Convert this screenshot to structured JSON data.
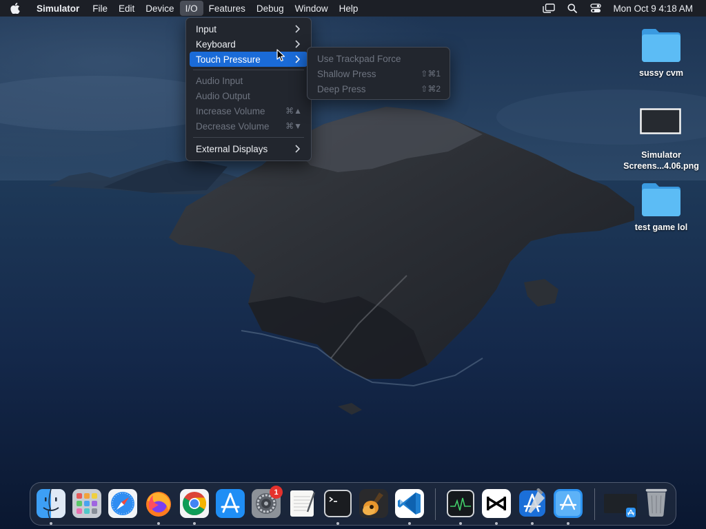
{
  "menubar": {
    "apple_icon": "apple-logo-icon",
    "app_name": "Simulator",
    "items": [
      "File",
      "Edit",
      "Device",
      "I/O",
      "Features",
      "Debug",
      "Window",
      "Help"
    ],
    "active_item": "I/O",
    "status_icons": [
      "stage-manager-icon",
      "search-icon",
      "control-center-icon"
    ],
    "clock": "Mon Oct 9  4:18 AM"
  },
  "io_menu": {
    "items": [
      {
        "label": "Input",
        "submenu": true,
        "enabled": true
      },
      {
        "label": "Keyboard",
        "submenu": true,
        "enabled": true
      },
      {
        "label": "Touch Pressure",
        "submenu": true,
        "enabled": true,
        "highlighted": true
      },
      {
        "label": "Audio Input",
        "enabled": false
      },
      {
        "label": "Audio Output",
        "enabled": false
      },
      {
        "label": "Increase Volume",
        "shortcut": "⌘▲",
        "enabled": false
      },
      {
        "label": "Decrease Volume",
        "shortcut": "⌘▼",
        "enabled": false
      },
      {
        "label": "External Displays",
        "submenu": true,
        "enabled": true
      }
    ]
  },
  "touch_pressure_submenu": {
    "items": [
      {
        "label": "Use Trackpad Force",
        "enabled": false
      },
      {
        "label": "Shallow Press",
        "shortcut": "⇧⌘1",
        "enabled": false
      },
      {
        "label": "Deep Press",
        "shortcut": "⇧⌘2",
        "enabled": false
      }
    ]
  },
  "desktop_icons": [
    {
      "label": "sussy cvm",
      "icon": "folder-icon"
    },
    {
      "label": "Simulator\nScreens...4.06.png",
      "label_line1": "Simulator",
      "label_line2": "Screens...4.06.png",
      "icon": "screenshot-thumbnail-icon"
    },
    {
      "label": "test game lol",
      "icon": "folder-icon"
    }
  ],
  "dock": {
    "apps": [
      {
        "name": "finder-icon",
        "running": true
      },
      {
        "name": "launchpad-icon",
        "running": false
      },
      {
        "name": "safari-icon",
        "running": false
      },
      {
        "name": "firefox-icon",
        "running": true
      },
      {
        "name": "chrome-icon",
        "running": true
      },
      {
        "name": "app-store-icon",
        "running": false
      },
      {
        "name": "system-settings-icon",
        "running": false,
        "badge": "1"
      },
      {
        "name": "textedit-icon",
        "running": false
      },
      {
        "name": "terminal-icon",
        "running": true
      },
      {
        "name": "garageband-icon",
        "running": false
      },
      {
        "name": "vscode-icon",
        "running": true
      },
      {
        "name": "activity-monitor-icon",
        "running": true
      },
      {
        "name": "capcut-icon",
        "running": true
      },
      {
        "name": "xcode-icon",
        "running": true
      },
      {
        "name": "simulator-icon",
        "running": true
      },
      {
        "name": "recent-window-icon",
        "running": false
      },
      {
        "name": "trash-icon",
        "running": false
      }
    ],
    "settings_badge": "1"
  },
  "colors": {
    "menu_highlight": "#1a6bd8",
    "menubar_bg": "#1c1f26",
    "menu_bg": "#22262e",
    "disabled_text": "#6e7480",
    "folder_blue": "#4fb2f0",
    "badge_red": "#e5322d"
  }
}
